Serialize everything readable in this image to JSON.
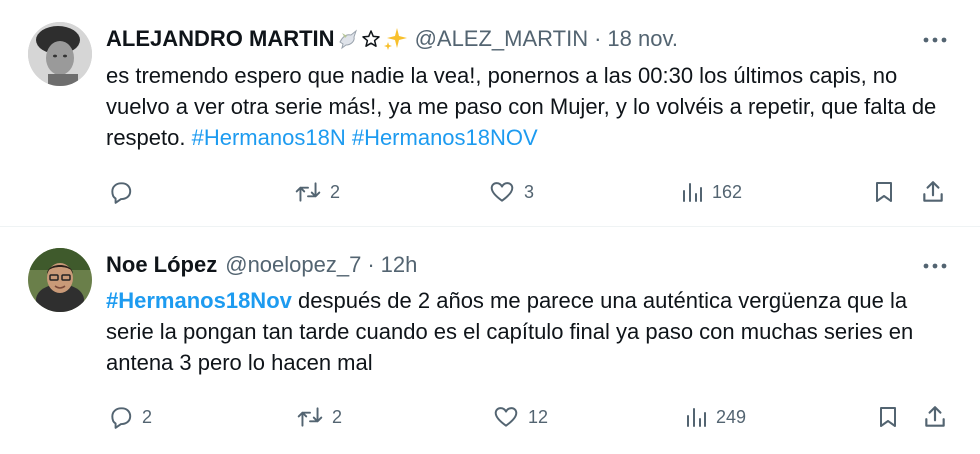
{
  "tweets": [
    {
      "author": {
        "name": "ALEJANDRO MARTIN",
        "badges": [
          "dove-emoji",
          "star-outline-emoji",
          "sparkles-emoji"
        ],
        "handle": "@ALEZ_MARTIN"
      },
      "time": "18 nov.",
      "dot": "·",
      "text": "es tremendo espero que nadie la vea!, ponernos a las 00:30 los últimos capis, no vuelvo a ver otra serie más!, ya me paso con Mujer, y lo volvéis a repetir, que falta de respeto.",
      "hashtags": [
        "#Hermanos18N",
        "#Hermanos18NOV"
      ],
      "stats": {
        "replies": "",
        "retweets": "2",
        "likes": "3",
        "views": "162"
      }
    },
    {
      "author": {
        "name": "Noe López",
        "handle": "@noelopez_7"
      },
      "time": "12h",
      "dot": "·",
      "hashtag": "#Hermanos18Nov",
      "text": "después de 2 años me parece una auténtica vergüenza que la serie la pongan tan tarde cuando es el capítulo final ya paso con muchas series en antena 3 pero lo hacen mal",
      "stats": {
        "replies": "2",
        "retweets": "2",
        "likes": "12",
        "views": "249"
      }
    }
  ],
  "colors": {
    "text": "#0f1419",
    "secondary": "#536471",
    "link": "#1d9bf0",
    "divider": "#eff3f4"
  }
}
